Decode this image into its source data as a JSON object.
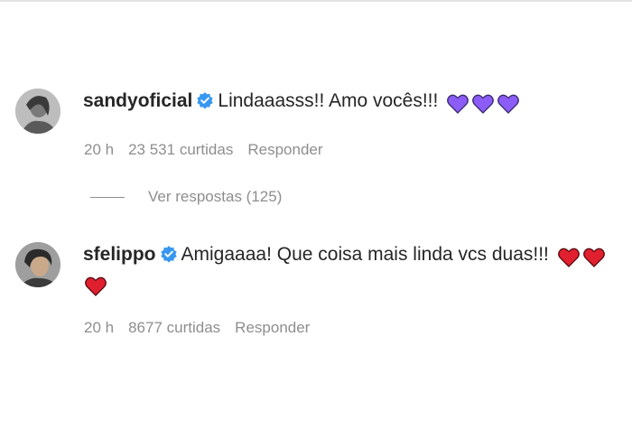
{
  "comments": [
    {
      "username": "sandyoficial",
      "verified": true,
      "text": "Lindaaasss!! Amo vocês!!!",
      "hearts": [
        "purple",
        "purple",
        "purple"
      ],
      "time": "20 h",
      "likes": "23 531 curtidas",
      "reply_label": "Responder",
      "view_replies": "Ver respostas (125)"
    },
    {
      "username": "sfelippo",
      "verified": true,
      "text": "Amigaaaa! Que coisa mais linda vcs duas!!!",
      "hearts": [
        "red",
        "red",
        "red"
      ],
      "time": "20 h",
      "likes": "8677 curtidas",
      "reply_label": "Responder"
    }
  ],
  "colors": {
    "verified_badge": "#3897f0",
    "purple_heart": "#8b5cf6",
    "red_heart": "#e0202f",
    "meta_text": "#8e8e8e"
  }
}
